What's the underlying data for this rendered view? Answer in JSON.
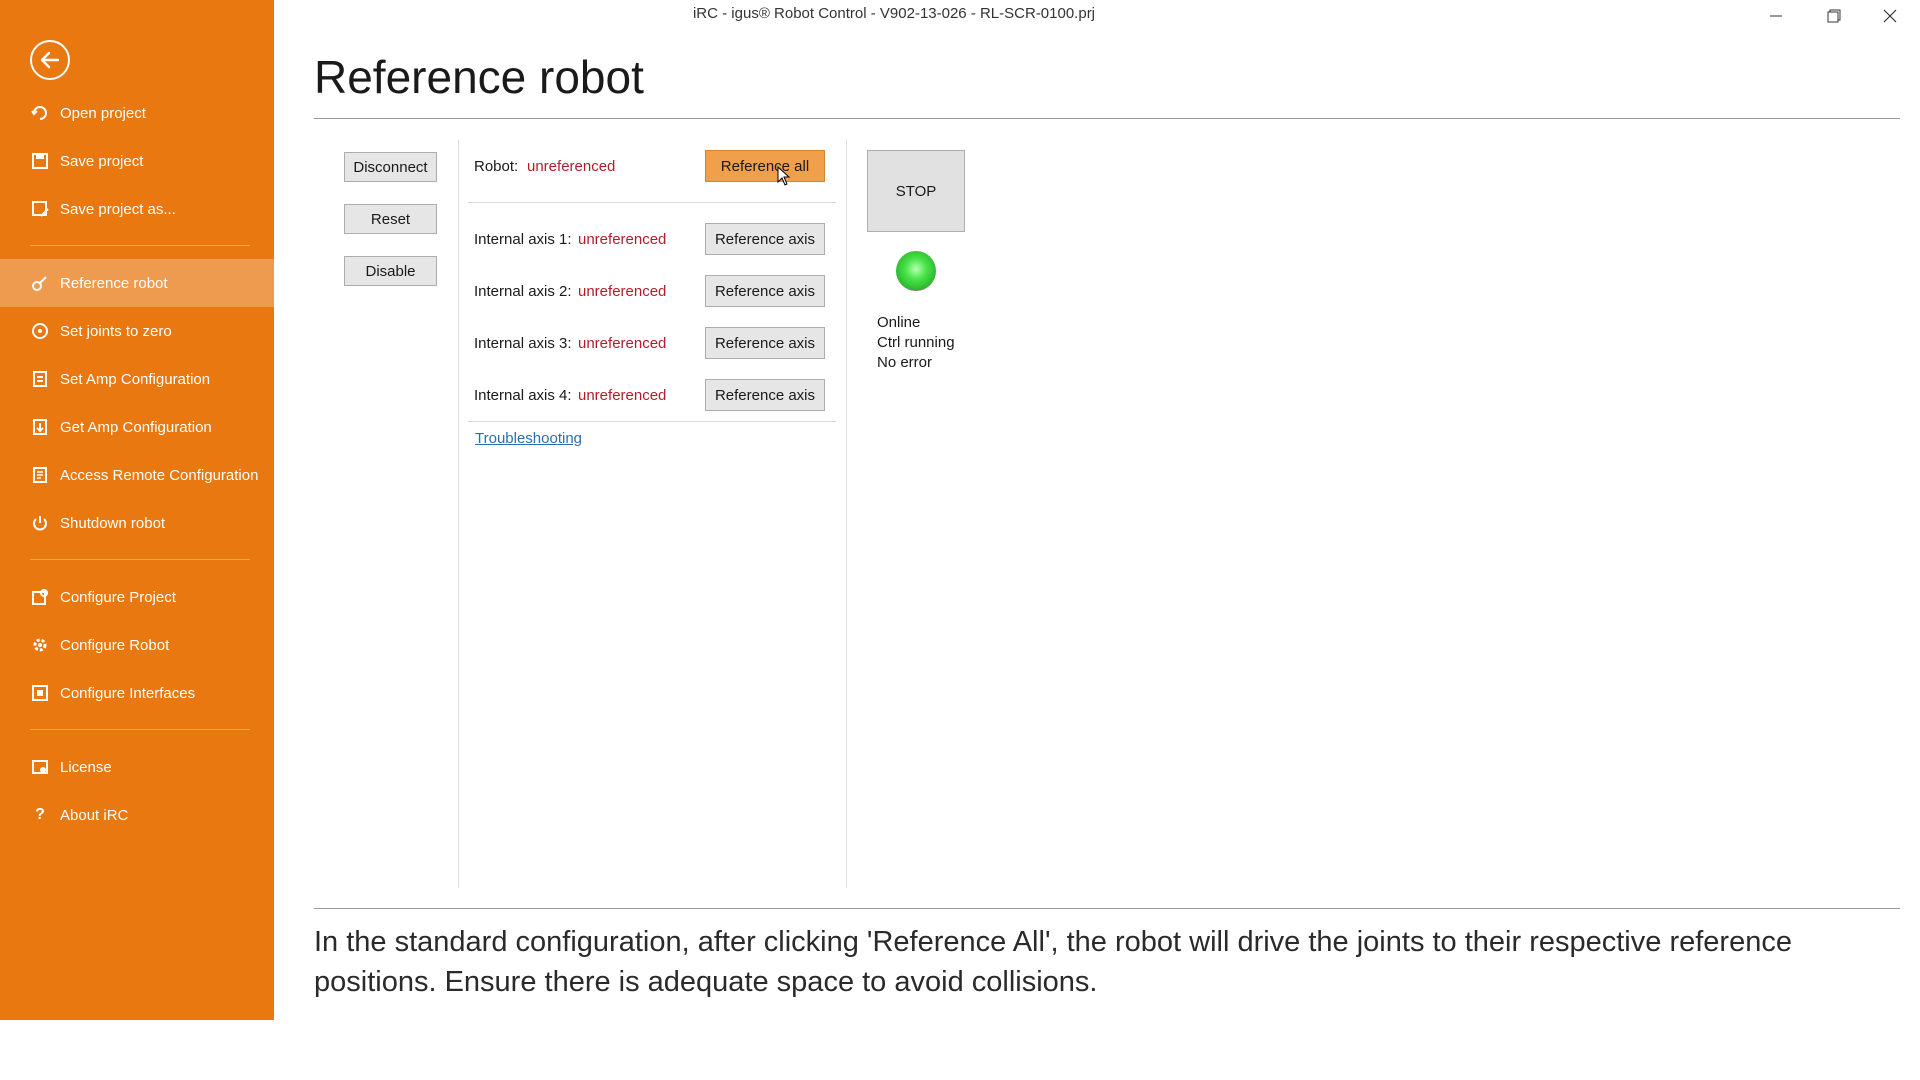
{
  "window": {
    "title": "iRC - igus® Robot Control - V902-13-026 - RL-SCR-0100.prj",
    "controls": [
      "minimize",
      "restore",
      "close"
    ]
  },
  "sidebar": {
    "back_icon": "arrow-left-circle-icon",
    "groups": [
      [
        {
          "label": "Open project",
          "icon": "open-project-icon"
        },
        {
          "label": "Save project",
          "icon": "save-icon"
        },
        {
          "label": "Save project as...",
          "icon": "save-as-icon"
        }
      ],
      [
        {
          "label": "Reference robot",
          "icon": "reference-robot-icon",
          "active": true
        },
        {
          "label": "Set joints to zero",
          "icon": "set-zero-icon"
        },
        {
          "label": "Set Amp Configuration",
          "icon": "set-amp-icon"
        },
        {
          "label": "Get Amp Configuration",
          "icon": "get-amp-icon"
        },
        {
          "label": "Access Remote Configuration",
          "icon": "remote-config-icon"
        },
        {
          "label": "Shutdown robot",
          "icon": "power-icon"
        }
      ],
      [
        {
          "label": "Configure Project",
          "icon": "configure-project-icon"
        },
        {
          "label": "Configure Robot",
          "icon": "gear-icon"
        },
        {
          "label": "Configure Interfaces",
          "icon": "interfaces-icon"
        }
      ],
      [
        {
          "label": "License",
          "icon": "license-icon"
        },
        {
          "label": "About iRC",
          "icon": "question-icon"
        }
      ]
    ]
  },
  "page": {
    "title": "Reference robot",
    "left_buttons": {
      "disconnect": "Disconnect",
      "reset": "Reset",
      "disable": "Disable"
    },
    "robot": {
      "label": "Robot:",
      "status": "unreferenced",
      "button": "Reference all"
    },
    "axes": [
      {
        "label": "Internal axis 1:",
        "status": "unreferenced",
        "button": "Reference axis"
      },
      {
        "label": "Internal axis 2:",
        "status": "unreferenced",
        "button": "Reference axis"
      },
      {
        "label": "Internal axis 3:",
        "status": "unreferenced",
        "button": "Reference axis"
      },
      {
        "label": "Internal axis 4:",
        "status": "unreferenced",
        "button": "Reference axis"
      }
    ],
    "troubleshooting": "Troubleshooting",
    "stop_button": "STOP",
    "status_led_color": "#49e44a",
    "status_lines": {
      "line1": "Online",
      "line2": "Ctrl running",
      "line3": "No error"
    },
    "info_text": "In the standard configuration, after clicking 'Reference All', the robot will drive the joints to their respective reference positions. Ensure there is adequate space to avoid collisions."
  },
  "colors": {
    "sidebar": "#e8780f",
    "sidebar_active": "#ee9a4f",
    "status_red": "#b01e2d",
    "accent_button": "#f0a04a"
  }
}
